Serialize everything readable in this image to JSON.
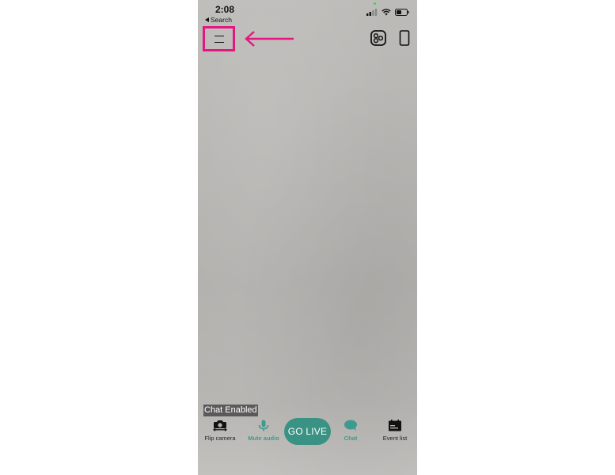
{
  "status_bar": {
    "time": "2:08",
    "back_label": "Search",
    "icons": [
      "signal-icon",
      "wifi-icon",
      "battery-icon"
    ]
  },
  "top_controls": {
    "menu_icon": "menu-icon",
    "annotation_arrow_color": "#e4177f",
    "filter_icon": "filter-icon",
    "orientation_icon": "phone-orientation-icon"
  },
  "chat_status": "Chat Enabled",
  "bottom_controls": {
    "flip_camera": "Flip camera",
    "mute_audio": "Mute audio",
    "go_live": "GO LIVE",
    "chat": "Chat",
    "event_list": "Event list"
  },
  "colors": {
    "accent": "#3a9284",
    "highlight": "#e4177f"
  }
}
